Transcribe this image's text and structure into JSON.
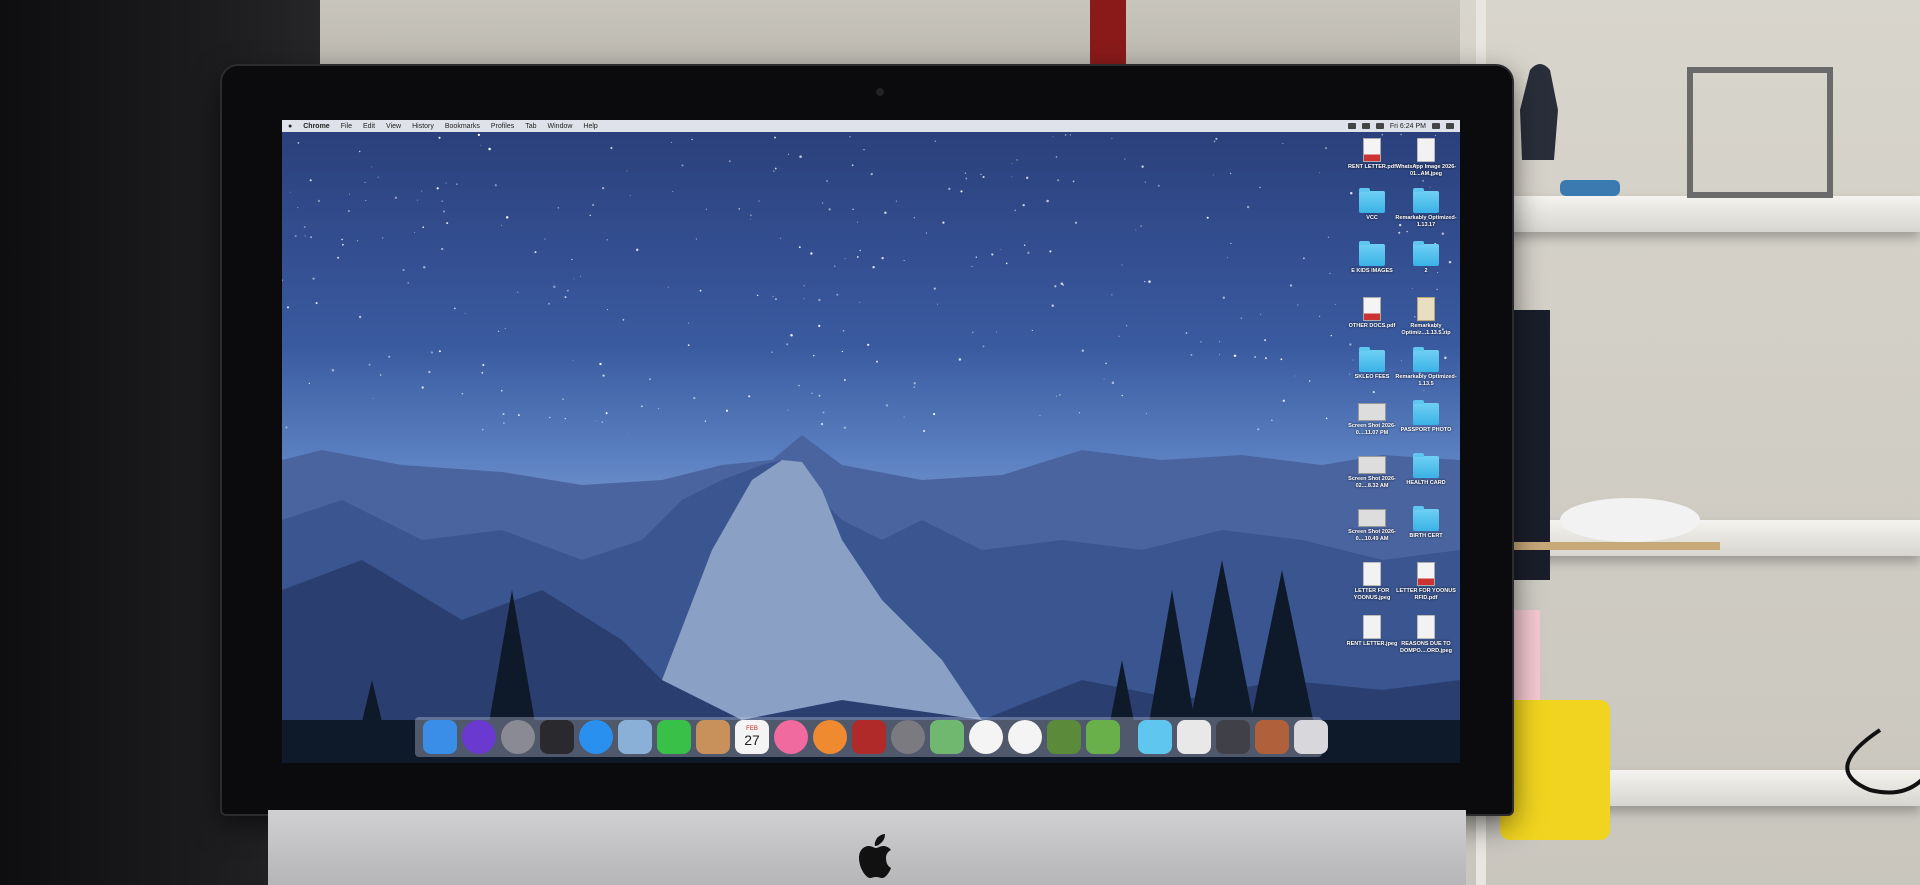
{
  "menubar": {
    "apple": "",
    "items": [
      "Chrome",
      "File",
      "Edit",
      "View",
      "History",
      "Bookmarks",
      "Profiles",
      "Tab",
      "Window",
      "Help"
    ],
    "clock": "Fri 6:24 PM"
  },
  "desktop_icons": [
    {
      "label": "RENT LETTER.pdf",
      "kind": "pdfdoc"
    },
    {
      "label": "WhatsApp Image 2026-01...AM.jpeg",
      "kind": "doc"
    },
    {
      "label": "VCC",
      "kind": "folder"
    },
    {
      "label": "Remarkably Optimized-1.13.17",
      "kind": "folder"
    },
    {
      "label": "E KIDS IMAGES",
      "kind": "folder"
    },
    {
      "label": "2",
      "kind": "folder"
    },
    {
      "label": "OTHER DOCS.pdf",
      "kind": "pdfdoc"
    },
    {
      "label": "Remarkably Optimiz...1.13.5.zip",
      "kind": "zip"
    },
    {
      "label": "SKLEO FEES",
      "kind": "folder"
    },
    {
      "label": "Remarkably Optimized-1.13.5",
      "kind": "folder"
    },
    {
      "label": "Screen Shot 2026-0....11.07 PM",
      "kind": "shot"
    },
    {
      "label": "PASSPORT PHOTO",
      "kind": "folder"
    },
    {
      "label": "Screen Shot 2026-02....8.32 AM",
      "kind": "shot"
    },
    {
      "label": "HEALTH CARD",
      "kind": "folder"
    },
    {
      "label": "Screen Shot 2026-0....10.49 AM",
      "kind": "shot"
    },
    {
      "label": "BIRTH CERT",
      "kind": "folder"
    },
    {
      "label": "LETTER FOR YOONUS.jpeg",
      "kind": "doc"
    },
    {
      "label": "LETTER FOR YOONUS RFID.pdf",
      "kind": "pdfdoc"
    },
    {
      "label": "RENT LETTER.jpeg",
      "kind": "doc"
    },
    {
      "label": "REASONS DUE TO DOMPO....ORD.jpeg",
      "kind": "doc"
    }
  ],
  "dock": {
    "apps": [
      {
        "name": "finder",
        "color": "#3a8ee8"
      },
      {
        "name": "siri",
        "color": "#6a3ad0"
      },
      {
        "name": "launchpad",
        "color": "#8a8a94"
      },
      {
        "name": "mission-control",
        "color": "#2a2a2e"
      },
      {
        "name": "app-store",
        "color": "#2a90f0"
      },
      {
        "name": "preview",
        "color": "#8ab0d8"
      },
      {
        "name": "facetime",
        "color": "#38c048"
      },
      {
        "name": "contacts",
        "color": "#c8905a"
      },
      {
        "name": "calendar",
        "color": "#f4f4f4"
      },
      {
        "name": "itunes",
        "color": "#f06aa0"
      },
      {
        "name": "ibooks",
        "color": "#f08a30"
      },
      {
        "name": "photo-booth",
        "color": "#b02a2a"
      },
      {
        "name": "system-preferences",
        "color": "#7a7a80"
      },
      {
        "name": "maps",
        "color": "#70b870"
      },
      {
        "name": "photos",
        "color": "#f4f4f4"
      },
      {
        "name": "chrome",
        "color": "#f4f4f4"
      },
      {
        "name": "minecraft",
        "color": "#5a8a3a"
      },
      {
        "name": "minecraft-launcher",
        "color": "#6ab04a"
      }
    ],
    "right": [
      {
        "name": "downloads-folder",
        "color": "#5ec6ef"
      },
      {
        "name": "documents-stack",
        "color": "#e8e8e8"
      },
      {
        "name": "screenshot-stack",
        "color": "#404048"
      },
      {
        "name": "image-stack",
        "color": "#b0603a"
      },
      {
        "name": "trash",
        "color": "#d8d8dc"
      }
    ],
    "calendar_month": "FEB",
    "calendar_day": "27"
  }
}
